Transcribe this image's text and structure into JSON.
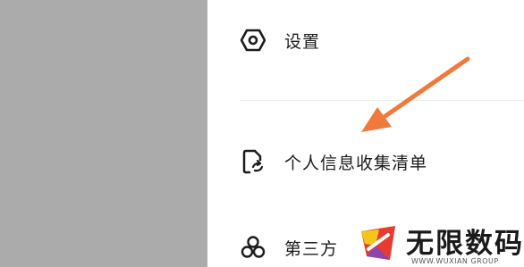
{
  "menu": {
    "items": [
      {
        "label": "设置",
        "icon": "hexagon-settings-icon"
      },
      {
        "label": "个人信息收集清单",
        "icon": "document-sync-icon"
      },
      {
        "label": "第三方",
        "icon": "three-circles-icon"
      }
    ]
  },
  "annotation": {
    "icon": "orange-arrow-icon",
    "color": "#f07a3c"
  },
  "watermark": {
    "title": "无限数码",
    "subtitle": "WWW.WUXIAN GROUP",
    "logo_colors": [
      "#f5c518",
      "#e63b2e",
      "#8e44ad"
    ]
  },
  "colors": {
    "overlay": "#ababab",
    "text": "#1c1c1c"
  }
}
